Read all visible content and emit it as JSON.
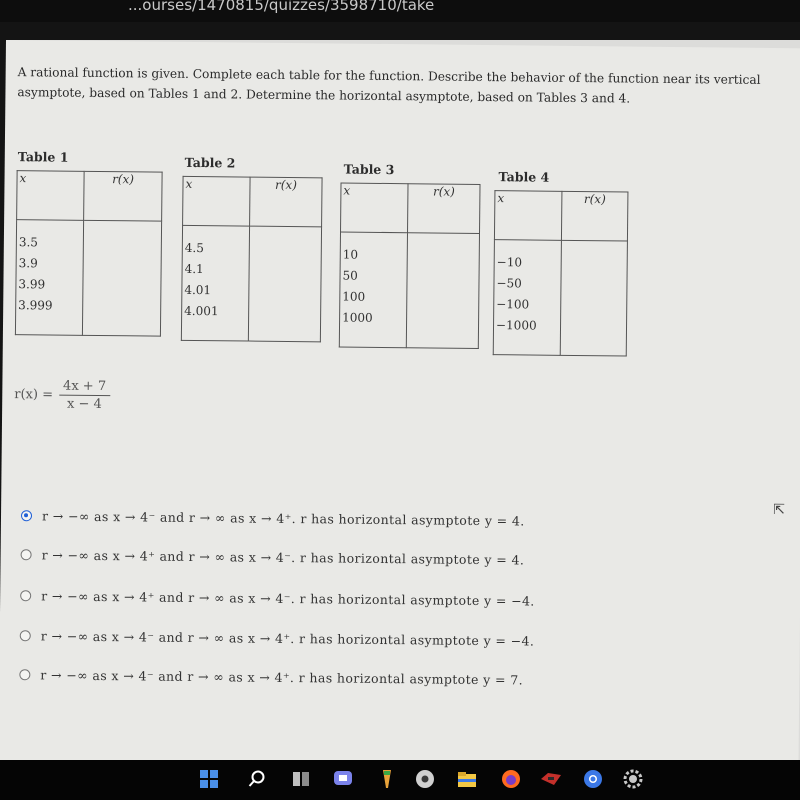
{
  "browser": {
    "url": "...ourses/1470815/quizzes/3598710/take"
  },
  "question": {
    "instructions": "A rational function is given. Complete each table for the function. Describe the behavior of the function near its vertical asymptote, based on Tables 1 and 2. Determine the horizontal asymptote, based on Tables 3 and 4."
  },
  "tables": [
    {
      "label": "Table 1",
      "x_header": "x",
      "r_header": "r(x)",
      "x_values": [
        "3.5",
        "3.9",
        "3.99",
        "3.999"
      ]
    },
    {
      "label": "Table 2",
      "x_header": "x",
      "r_header": "r(x)",
      "x_values": [
        "4.5",
        "4.1",
        "4.01",
        "4.001"
      ]
    },
    {
      "label": "Table 3",
      "x_header": "x",
      "r_header": "r(x)",
      "x_values": [
        "10",
        "50",
        "100",
        "1000"
      ]
    },
    {
      "label": "Table 4",
      "x_header": "x",
      "r_header": "r(x)",
      "x_values": [
        "−10",
        "−50",
        "−100",
        "−1000"
      ]
    }
  ],
  "function": {
    "lhs": "r(x) =",
    "numerator": "4x + 7",
    "denominator": "x − 4"
  },
  "options": [
    {
      "text": "r → −∞ as x → 4⁻ and r → ∞ as x → 4⁺. r has horizontal asymptote y = 4.",
      "selected": true
    },
    {
      "text": "r → −∞ as x → 4⁺ and r → ∞ as x → 4⁻. r has horizontal asymptote y = 4.",
      "selected": false
    },
    {
      "text": "r → −∞ as x → 4⁺ and r → ∞ as x → 4⁻. r has horizontal asymptote y = −4.",
      "selected": false
    },
    {
      "text": "r → −∞ as x → 4⁻ and r → ∞ as x → 4⁺. r has horizontal asymptote y = −4.",
      "selected": false
    },
    {
      "text": "r → −∞ as x → 4⁻ and r → ∞ as x → 4⁺. r has horizontal asymptote y = 7.",
      "selected": false
    }
  ],
  "taskbar": {
    "icons": [
      {
        "name": "windows-start-icon",
        "color": "#4a8fe7"
      },
      {
        "name": "search-icon",
        "color": "#ffffff"
      },
      {
        "name": "task-view-icon",
        "color": "#bfbfbf"
      },
      {
        "name": "teams-chat-icon",
        "color": "#7b83eb"
      },
      {
        "name": "app-icon",
        "color": "#e8a33a"
      },
      {
        "name": "settings-app-icon",
        "color": "#d0d0d0"
      },
      {
        "name": "file-explorer-icon",
        "color": "#f2c744"
      },
      {
        "name": "firefox-icon",
        "color": "#ff6a1f"
      },
      {
        "name": "game-app-icon",
        "color": "#c4302b"
      },
      {
        "name": "chrome-icon",
        "color": "#3b78e7"
      },
      {
        "name": "gear-icon",
        "color": "#c8c8c8"
      }
    ]
  }
}
